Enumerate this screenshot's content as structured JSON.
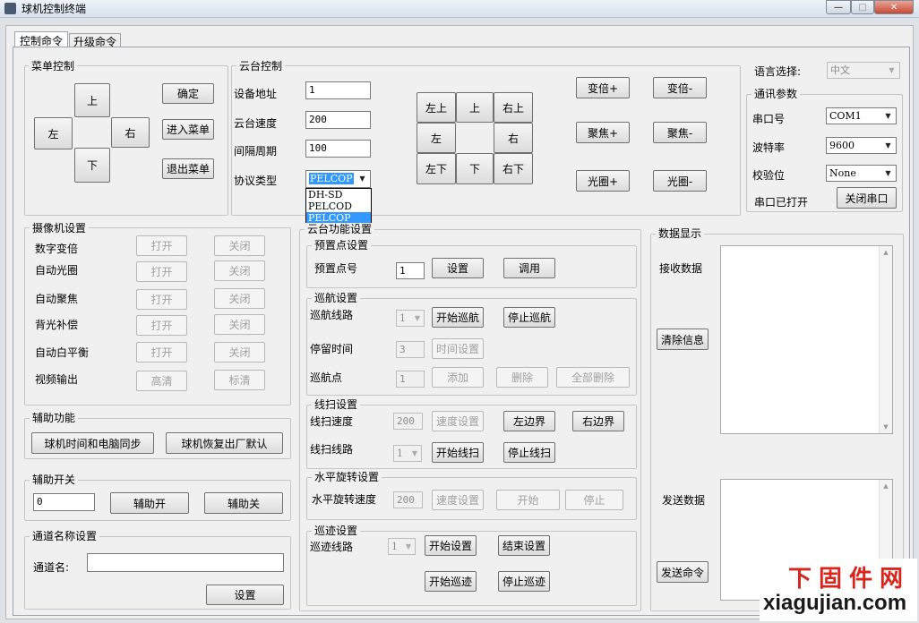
{
  "window": {
    "title": "球机控制终端",
    "min_glyph": "—",
    "max_glyph": "□",
    "close_glyph": "✕"
  },
  "tabs": [
    {
      "label": "控制命令"
    },
    {
      "label": "升级命令"
    }
  ],
  "menu_control": {
    "title": "菜单控制",
    "up": "上",
    "down": "下",
    "left": "左",
    "right": "右",
    "confirm": "确定",
    "enter_menu": "进入菜单",
    "exit_menu": "退出菜单"
  },
  "ptz_control": {
    "title": "云台控制",
    "address_label": "设备地址",
    "address_value": "1",
    "speed_label": "云台速度",
    "speed_value": "200",
    "interval_label": "间隔周期",
    "interval_value": "100",
    "protocol_label": "协议类型",
    "protocol_value": "PELCOP",
    "protocol_options": [
      "DH-SD",
      "PELCOD",
      "PELCOP"
    ],
    "dir": {
      "ul": "左上",
      "u": "上",
      "ur": "右上",
      "l": "左",
      "r": "右",
      "dl": "左下",
      "d": "下",
      "dr": "右下"
    },
    "zoom_in": "变倍+",
    "zoom_out": "变倍-",
    "focus_in": "聚焦+",
    "focus_out": "聚焦-",
    "iris_in": "光圈+",
    "iris_out": "光圈-"
  },
  "language": {
    "label": "语言选择:",
    "value": "中文"
  },
  "comm": {
    "title": "通讯参数",
    "port_label": "串口号",
    "port_value": "COM1",
    "baud_label": "波特率",
    "baud_value": "9600",
    "parity_label": "校验位",
    "parity_value": "None",
    "status": "串口已打开",
    "close_port": "关闭串口"
  },
  "camera": {
    "title": "摄像机设置",
    "rows": [
      {
        "label": "数字变倍",
        "a": "打开",
        "b": "关闭"
      },
      {
        "label": "自动光圈",
        "a": "打开",
        "b": "关闭"
      },
      {
        "label": "自动聚焦",
        "a": "打开",
        "b": "关闭"
      },
      {
        "label": "背光补偿",
        "a": "打开",
        "b": "关闭"
      },
      {
        "label": "自动白平衡",
        "a": "打开",
        "b": "关闭"
      },
      {
        "label": "视频输出",
        "a": "高清",
        "b": "标清"
      }
    ]
  },
  "aux_func": {
    "title": "辅助功能",
    "sync_time": "球机时间和电脑同步",
    "factory_reset": "球机恢复出厂默认"
  },
  "aux_switch": {
    "title": "辅助开关",
    "value": "0",
    "on": "辅助开",
    "off": "辅助关"
  },
  "channel": {
    "title": "通道名称设置",
    "label": "通道名:",
    "value": "",
    "set": "设置"
  },
  "ptz_func": {
    "title": "云台功能设置",
    "preset": {
      "title": "预置点设置",
      "label": "预置点号",
      "value": "1",
      "set": "设置",
      "call": "调用"
    },
    "cruise": {
      "title": "巡航设置",
      "route_label": "巡航线路",
      "route_value": "1",
      "start": "开始巡航",
      "stop": "停止巡航",
      "dwell_label": "停留时间",
      "dwell_value": "3",
      "time_set": "时间设置",
      "point_label": "巡航点",
      "point_value": "1",
      "add": "添加",
      "delete": "删除",
      "delete_all": "全部删除"
    },
    "scan": {
      "title": "线扫设置",
      "speed_label": "线扫速度",
      "speed_value": "200",
      "speed_set": "速度设置",
      "left": "左边界",
      "right": "右边界",
      "route_label": "线扫线路",
      "route_value": "1",
      "start": "开始线扫",
      "stop": "停止线扫"
    },
    "rotate": {
      "title": "水平旋转设置",
      "speed_label": "水平旋转速度",
      "speed_value": "200",
      "speed_set": "速度设置",
      "start": "开始",
      "stop": "停止"
    },
    "track": {
      "title": "巡迹设置",
      "route_label": "巡迹线路",
      "route_value": "1",
      "start_set": "开始设置",
      "end_set": "结束设置",
      "start": "开始巡迹",
      "stop": "停止巡迹"
    }
  },
  "data_display": {
    "title": "数据显示",
    "recv_label": "接收数据",
    "clear": "清除信息",
    "send_label": "发送数据",
    "send": "发送命令"
  },
  "watermark": {
    "cn": "下固件网",
    "url": "xiagujian.com"
  }
}
